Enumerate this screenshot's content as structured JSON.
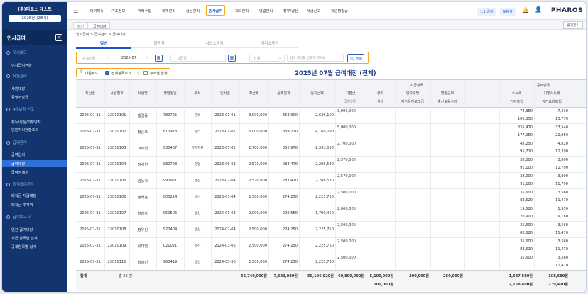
{
  "company": {
    "name": "(주)피로스 테스트",
    "period": "2025년 (28기)"
  },
  "sidebar": {
    "title": "인사급여",
    "collapse": "<",
    "sections": [
      {
        "label": "대시보드",
        "items": [
          "인사급여현황"
        ]
      },
      {
        "label": "사원관리",
        "items": [
          "사원대장",
          "증명서발급"
        ]
      },
      {
        "label": "4대보험 신고",
        "items": [
          "취득/상실/피부양자",
          "인원처리현황조회"
        ]
      },
      {
        "label": "급여관리",
        "items": [
          "급여입력",
          "급여대장",
          "급여명세서"
        ]
      },
      {
        "label": "퇴직급여관리",
        "items": [
          "퇴직금 지급대장",
          "퇴직금 추계액"
        ]
      },
      {
        "label": "급여보고서",
        "items": [
          "연간 급여대장",
          "지급 항목별 집계",
          "공제항목별 집계"
        ]
      }
    ]
  },
  "topnav": {
    "items": [
      "마이메뉴",
      "기초정보",
      "거래수집",
      "회계관리",
      "금융관리",
      "인사급여",
      "재고관리",
      "영업관리",
      "장부/결산",
      "세금신고",
      "재증명발급"
    ],
    "active": "인사급여",
    "version": "1.1 공지",
    "help": "도움말",
    "logo": "PHAROS"
  },
  "pagetabs": {
    "items": [
      "메인",
      "급여대장"
    ],
    "favorite": "즐겨찾기"
  },
  "breadcrumb": "인사급여  >  급여관리  >  급여대장",
  "subtabs": [
    "일반",
    "일용직",
    "사업소득자",
    "기타소득자"
  ],
  "filter": {
    "period_label": "귀속년월",
    "period_value": "2025-07",
    "payday_placeholder": "지급일",
    "all_label": "전체",
    "search_placeholder": "검색 조건을 선택해 주세요",
    "search_btn": "조회"
  },
  "options": {
    "download": "다운로드",
    "show_all": "전체항목보기",
    "dept_sum": "부서별 합계"
  },
  "report_title": "2025년 07월 급여대장 (전체)",
  "table": {
    "headers": {
      "pay_date": "지급일",
      "emp_no": "사원번호",
      "name": "사원명",
      "birth": "생년월일",
      "dept": "부서",
      "join": "입사일",
      "total_pay": "지급액",
      "deduct": "공제합계",
      "net": "실지급액",
      "pay_group": "지급항목",
      "base": "기본급",
      "bonus": "상여",
      "extra": "연차수당",
      "overtime": "연장근무",
      "extra_sub": "자가운전보조금",
      "meal": "식대",
      "child": "출산보육수당",
      "deduct_group": "공제항목",
      "income_tax": "소득세",
      "local_tax": "지방소득세",
      "np": "국민연금",
      "hi": "건강보험",
      "ltc": "장기요양보험"
    },
    "rows": [
      {
        "date": "2025-07-31",
        "no": "23010101",
        "name": "홍길동",
        "birth": "780725",
        "dept": "관리",
        "join": "2023-01-01",
        "pay": "3,000,000",
        "ded": "363,900",
        "net": "2,636,100",
        "base": "3,000,000",
        "t1": "74,350",
        "t2": "106,350",
        "l1": "7,430",
        "l2": "13,770"
      },
      {
        "date": "2025-07-31",
        "no": "23010102",
        "name": "정준호",
        "birth": "810918",
        "dept": "관리",
        "join": "2023-01-01",
        "pay": "5,000,000",
        "ded": "839,210",
        "net": "4,160,790",
        "base": "5,000,000",
        "t1": "335,470",
        "t2": "177,250",
        "l1": "33,540",
        "l2": "22,950"
      },
      {
        "date": "2025-07-31",
        "no": "23010103",
        "name": "이수연",
        "birth": "030407",
        "dept": "경영지원",
        "join": "2023-05-02",
        "pay": "2,700,000",
        "ded": "306,970",
        "net": "2,393,030",
        "base": "2,700,000",
        "t1": "48,250",
        "t2": "95,710",
        "l1": "4,820",
        "l2": "12,390"
      },
      {
        "date": "2025-07-31",
        "no": "23010104",
        "name": "장서연",
        "birth": "980728",
        "dept": "영업",
        "join": "2023-06-03",
        "pay": "2,570,000",
        "ded": "283,470",
        "net": "2,286,530",
        "base": "2,570,000",
        "t1": "38,000",
        "t2": "91,100",
        "l1": "3,800",
        "l2": "11,790"
      },
      {
        "date": "2025-07-31",
        "no": "23010105",
        "name": "임동사",
        "birth": "990921",
        "dept": "생산",
        "join": "2023-07-04",
        "pay": "2,570,000",
        "ded": "283,470",
        "net": "2,286,530",
        "base": "2,570,000",
        "t1": "38,000",
        "t2": "91,100",
        "l1": "3,800",
        "l2": "11,790"
      },
      {
        "date": "2025-07-31",
        "no": "23010106",
        "name": "정하윤",
        "birth": "000214",
        "dept": "생산",
        "join": "2023-07-04",
        "pay": "2,500,000",
        "ded": "274,250",
        "net": "2,225,750",
        "base": "2,500,000",
        "t1": "35,600",
        "t2": "88,620",
        "l1": "3,560",
        "l2": "11,470"
      },
      {
        "date": "2025-07-31",
        "no": "23010107",
        "name": "최강자",
        "birth": "050506",
        "dept": "생산",
        "join": "2024-01-03",
        "pay": "2,000,000",
        "ded": "209,550",
        "net": "1,790,450",
        "base": "2,000,000",
        "t1": "19,520",
        "t2": "70,900",
        "l1": "1,950",
        "l2": "9,180"
      },
      {
        "date": "2025-07-31",
        "no": "23010108",
        "name": "정유진",
        "birth": "920404",
        "dept": "생산",
        "join": "2024-02-04",
        "pay": "2,500,000",
        "ded": "274,250",
        "net": "2,225,750",
        "base": "2,500,000",
        "t1": "35,600",
        "t2": "88,620",
        "l1": "3,560",
        "l2": "11,470"
      },
      {
        "date": "2025-07-31",
        "no": "23010109",
        "name": "유다연",
        "birth": "021021",
        "dept": "생산",
        "join": "2024-03-05",
        "pay": "2,500,000",
        "ded": "274,250",
        "net": "2,225,750",
        "base": "2,500,000",
        "t1": "35,600",
        "t2": "88,620",
        "l1": "3,560",
        "l2": "11,470"
      },
      {
        "date": "2025-07-31",
        "no": "23010110",
        "name": "최예빈",
        "birth": "960419",
        "dept": "생산",
        "join": "2024-03-30",
        "pay": "2,500,000",
        "ded": "274,250",
        "net": "2,225,750",
        "base": "2,500,000",
        "t1": "35,600",
        "t2": "",
        "l1": "3,560",
        "l2": "11,470"
      }
    ],
    "footer": {
      "label": "합계",
      "count": "총 26 건",
      "pay": "66,740,000원",
      "ded": "7,633,080원",
      "net": "59,106,920원",
      "base": "60,800,000원",
      "bonus": "5,100,000원",
      "bonus2": "200,000원",
      "extra": "300,000원",
      "overtime": "250,000원",
      "tax1": "1,687,580원",
      "tax2": "2,158,490원",
      "local1": "168,680원",
      "local2": "279,420원"
    }
  }
}
